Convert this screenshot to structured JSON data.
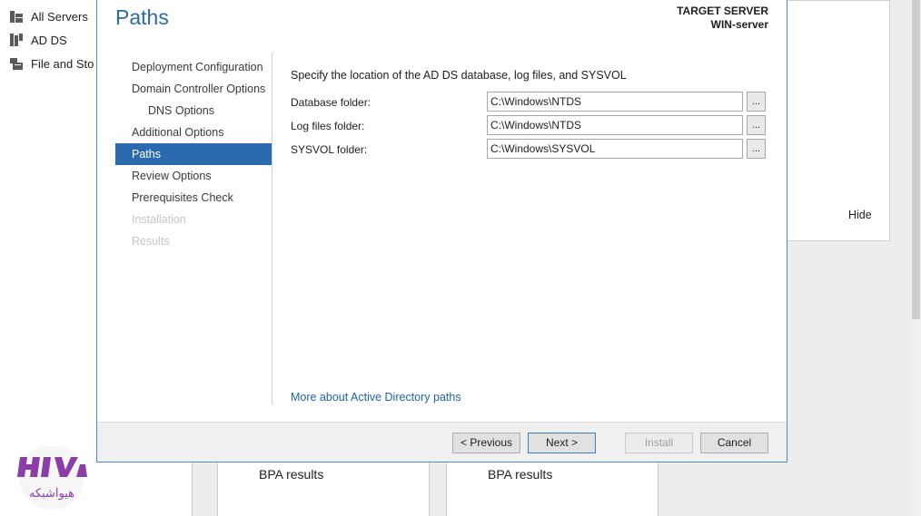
{
  "server_manager": {
    "nav": [
      {
        "label": "All Servers",
        "icon": "servers-icon"
      },
      {
        "label": "AD DS",
        "icon": "ad-ds-icon"
      },
      {
        "label": "File and Sto",
        "icon": "file-storage-icon"
      }
    ],
    "hide_label": "Hide",
    "tiles": [
      {
        "label": "BPA results"
      },
      {
        "label": "BPA results"
      }
    ]
  },
  "wizard": {
    "title": "Paths",
    "target_server_label": "TARGET SERVER",
    "target_server_name": "WIN-server",
    "steps": [
      {
        "label": "Deployment Configuration",
        "state": "normal"
      },
      {
        "label": "Domain Controller Options",
        "state": "normal"
      },
      {
        "label": "DNS Options",
        "state": "sub"
      },
      {
        "label": "Additional Options",
        "state": "normal"
      },
      {
        "label": "Paths",
        "state": "active"
      },
      {
        "label": "Review Options",
        "state": "normal"
      },
      {
        "label": "Prerequisites Check",
        "state": "normal"
      },
      {
        "label": "Installation",
        "state": "disabled"
      },
      {
        "label": "Results",
        "state": "disabled"
      }
    ],
    "heading": "Specify the location of the AD DS database, log files, and SYSVOL",
    "fields": [
      {
        "label": "Database folder:",
        "value": "C:\\Windows\\NTDS",
        "browse": "..."
      },
      {
        "label": "Log files folder:",
        "value": "C:\\Windows\\NTDS",
        "browse": "..."
      },
      {
        "label": "SYSVOL folder:",
        "value": "C:\\Windows\\SYSVOL",
        "browse": "..."
      }
    ],
    "more_link": "More about Active Directory paths",
    "buttons": {
      "previous": "< Previous",
      "next": "Next >",
      "install": "Install",
      "cancel": "Cancel"
    }
  },
  "watermark": {
    "logo_text": "HIVA",
    "logo_subtext": "هیواشبکه",
    "colors": {
      "primary": "#8a3fa8",
      "secondary": "#b07ac8"
    }
  },
  "colors": {
    "accent": "#2a6bb0",
    "title": "#2b6ba4",
    "link": "#1f63a8"
  }
}
